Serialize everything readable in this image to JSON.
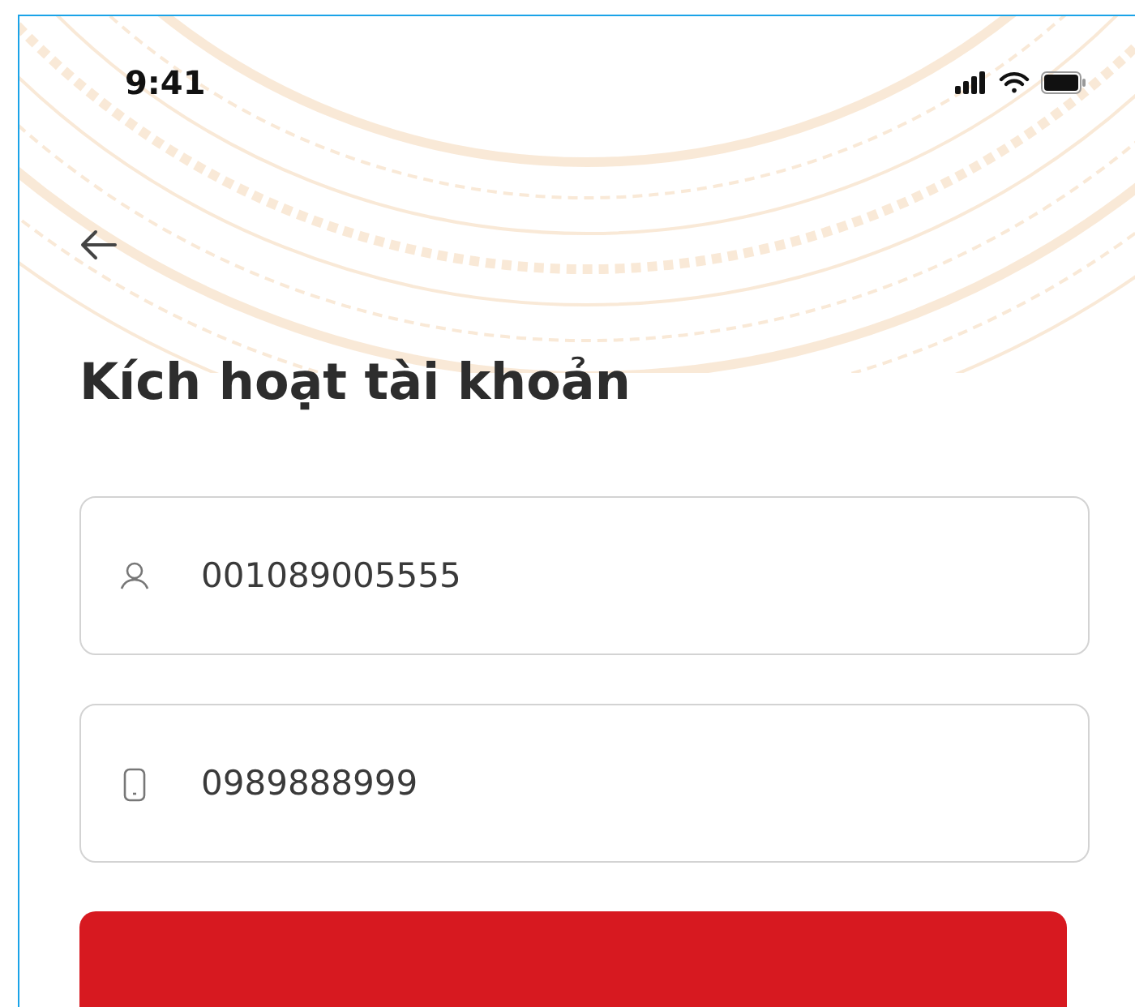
{
  "status_bar": {
    "time": "9:41"
  },
  "title": "Kích hoạt tài khoản",
  "fields": [
    {
      "kind": "user",
      "value": "001089005555"
    },
    {
      "kind": "phone",
      "value": "0989888999"
    }
  ]
}
